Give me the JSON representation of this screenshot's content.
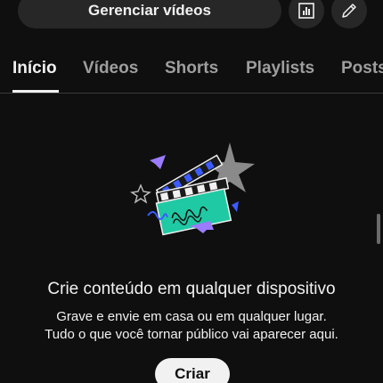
{
  "header": {
    "manage_videos_label": "Gerenciar vídeos",
    "analytics_icon": "bar-chart-icon",
    "edit_icon": "pencil-icon"
  },
  "tabs": [
    {
      "label": "Início",
      "active": true
    },
    {
      "label": "Vídeos",
      "active": false
    },
    {
      "label": "Shorts",
      "active": false
    },
    {
      "label": "Playlists",
      "active": false
    },
    {
      "label": "Posts",
      "active": false
    }
  ],
  "empty_state": {
    "illustration_icon": "clapperboard-illustration",
    "title": "Crie conteúdo em qualquer dispositivo",
    "line1": "Grave e envie em casa ou em qualquer lugar.",
    "line2": "Tudo o que você tornar público vai aparecer aqui.",
    "create_label": "Criar"
  },
  "colors": {
    "background": "#0f0f0f",
    "surface": "#272727",
    "text": "#f1f1f1",
    "muted": "#9e9e9e",
    "accent_teal": "#1fc9a3",
    "accent_blue": "#3b5bff",
    "accent_purple": "#9b7bff"
  }
}
